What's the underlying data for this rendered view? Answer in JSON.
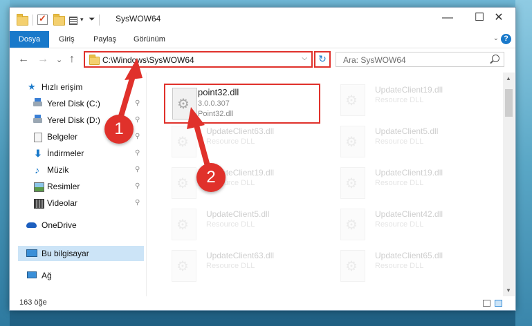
{
  "window": {
    "title": "SysWOW64",
    "controls": {
      "minimize": "—",
      "maximize": "☐",
      "close": "✕"
    }
  },
  "ribbon": {
    "tabs": [
      {
        "label": "Dosya",
        "active": true
      },
      {
        "label": "Giriş",
        "active": false
      },
      {
        "label": "Paylaş",
        "active": false
      },
      {
        "label": "Görünüm",
        "active": false
      }
    ],
    "help": "?"
  },
  "nav": {
    "back": "←",
    "forward": "→",
    "recent": "⌄",
    "up": "↑",
    "address": "C:\\Windows\\SysWOW64",
    "refresh": "↻",
    "search_placeholder": "Ara: SysWOW64"
  },
  "sidebar": {
    "items": [
      {
        "label": "Hızlı erişim",
        "icon": "star-icon",
        "pinned": false
      },
      {
        "label": "Yerel Disk (C:)",
        "icon": "drive-c-icon",
        "pinned": true
      },
      {
        "label": "Yerel Disk (D:)",
        "icon": "drive-d-icon",
        "pinned": true
      },
      {
        "label": "Belgeler",
        "icon": "documents-icon",
        "pinned": true
      },
      {
        "label": "İndirmeler",
        "icon": "downloads-icon",
        "pinned": true
      },
      {
        "label": "Müzik",
        "icon": "music-icon",
        "pinned": true
      },
      {
        "label": "Resimler",
        "icon": "pictures-icon",
        "pinned": true
      },
      {
        "label": "Videolar",
        "icon": "videos-icon",
        "pinned": true
      },
      {
        "label": "OneDrive",
        "icon": "onedrive-icon",
        "pinned": false
      },
      {
        "label": "Bu bilgisayar",
        "icon": "this-pc-icon",
        "pinned": false,
        "selected": true
      },
      {
        "label": "Ağ",
        "icon": "network-icon",
        "pinned": false
      }
    ],
    "pin_glyph": "📌"
  },
  "files": [
    {
      "name": "point32.dll",
      "version": "3.0.0.307",
      "desc": "Point32.dll",
      "highlighted": true
    },
    {
      "name": "UpdateClient19.dll",
      "desc": "Resource DLL"
    },
    {
      "name": "UpdateClient63.dll",
      "desc": "Resource DLL"
    },
    {
      "name": "UpdateClient5.dll",
      "desc": "Resource DLL"
    },
    {
      "name": "UpdateClient19.dll",
      "desc": "Resource DLL"
    },
    {
      "name": "UpdateClient19.dll",
      "desc": "Resource DLL"
    },
    {
      "name": "UpdateClient5.dll",
      "desc": "Resource DLL"
    },
    {
      "name": "UpdateClient42.dll",
      "desc": "Resource DLL"
    },
    {
      "name": "UpdateClient63.dll",
      "desc": "Resource DLL"
    },
    {
      "name": "UpdateClient65.dll",
      "desc": "Resource DLL"
    }
  ],
  "status": {
    "count": "163 öğe"
  },
  "annotations": {
    "badge1": "1",
    "badge2": "2"
  },
  "colors": {
    "accent": "#1979ca",
    "highlight": "#e0312b",
    "selection": "#cce4f7"
  }
}
